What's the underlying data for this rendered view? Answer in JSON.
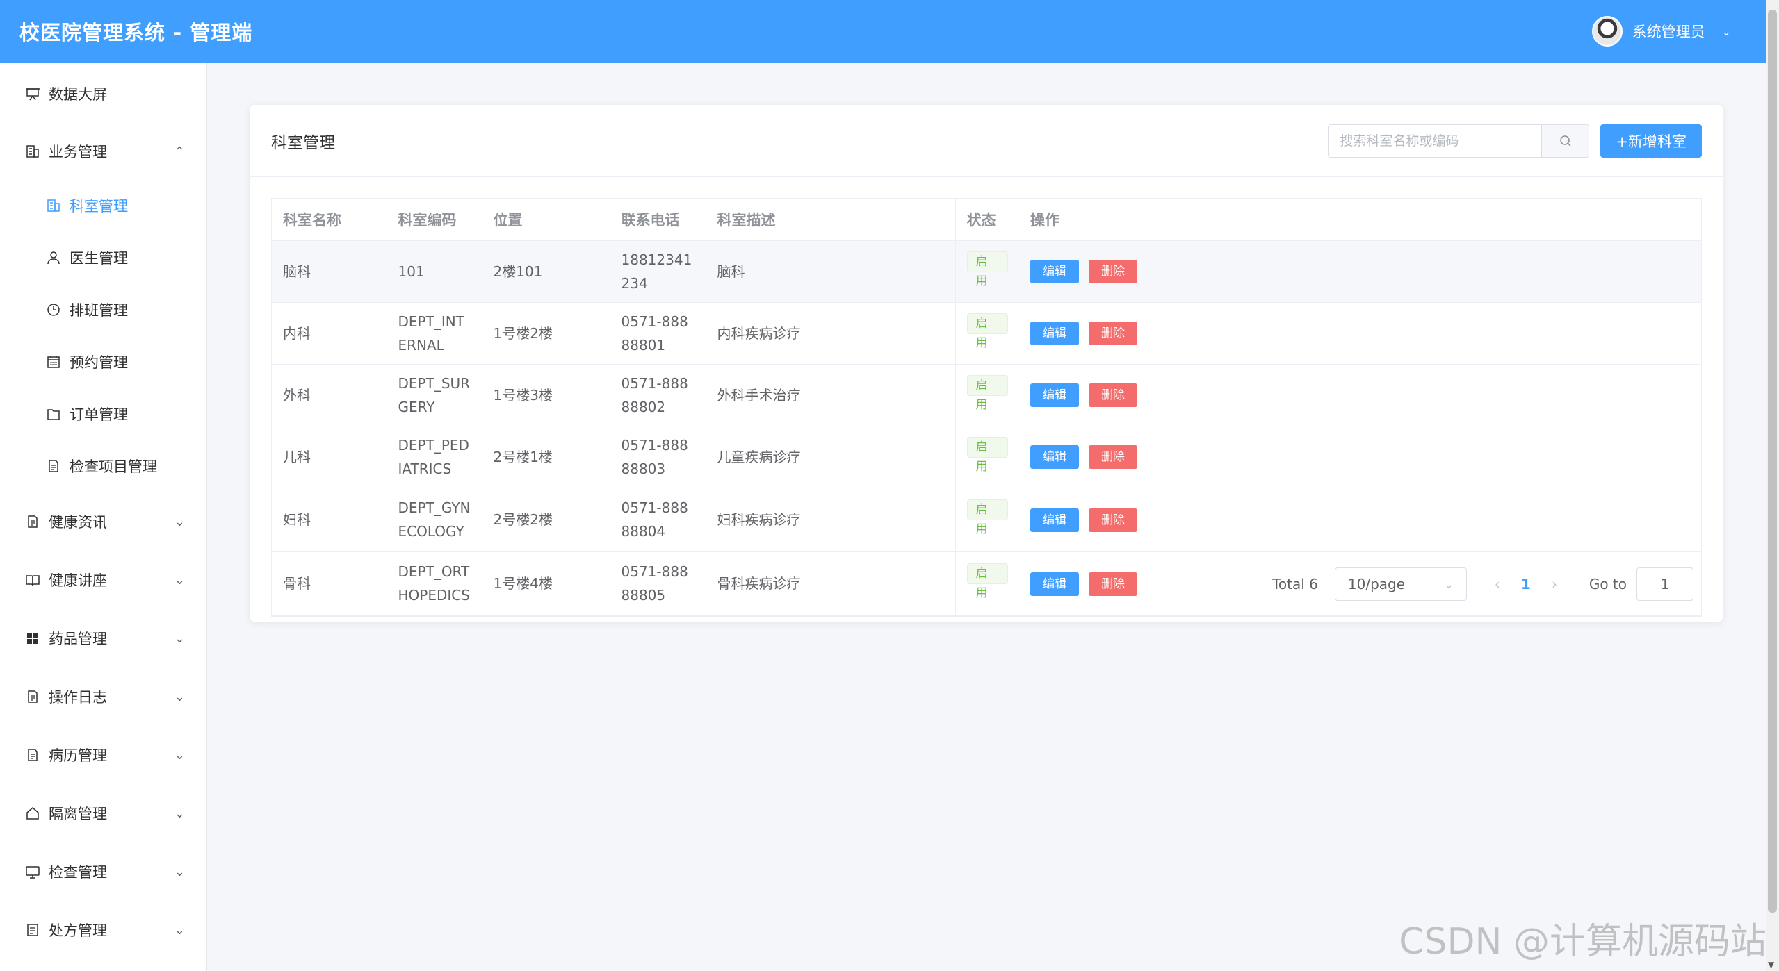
{
  "header": {
    "title": "校医院管理系统 - 管理端",
    "user_name": "系统管理员"
  },
  "sidebar": {
    "items": [
      {
        "label": "数据大屏",
        "icon": "presentation-icon",
        "level": 1,
        "arrow": ""
      },
      {
        "label": "业务管理",
        "icon": "office-building-icon",
        "level": 1,
        "arrow": "⌃"
      },
      {
        "label": "科室管理",
        "icon": "office-building-icon",
        "level": 2,
        "arrow": "",
        "active": true
      },
      {
        "label": "医生管理",
        "icon": "user-icon",
        "level": 2,
        "arrow": ""
      },
      {
        "label": "排班管理",
        "icon": "clock-icon",
        "level": 2,
        "arrow": ""
      },
      {
        "label": "预约管理",
        "icon": "calendar-icon",
        "level": 2,
        "arrow": ""
      },
      {
        "label": "订单管理",
        "icon": "folder-icon",
        "level": 2,
        "arrow": ""
      },
      {
        "label": "检查项目管理",
        "icon": "document-icon",
        "level": 2,
        "arrow": ""
      },
      {
        "label": "健康资讯",
        "icon": "document-icon",
        "level": 1,
        "arrow": "⌄"
      },
      {
        "label": "健康讲座",
        "icon": "book-icon",
        "level": 1,
        "arrow": "⌄"
      },
      {
        "label": "药品管理",
        "icon": "grid-icon",
        "level": 1,
        "arrow": "⌄"
      },
      {
        "label": "操作日志",
        "icon": "document-icon",
        "level": 1,
        "arrow": "⌄"
      },
      {
        "label": "病历管理",
        "icon": "document-icon",
        "level": 1,
        "arrow": "⌄"
      },
      {
        "label": "隔离管理",
        "icon": "house-icon",
        "level": 1,
        "arrow": "⌄"
      },
      {
        "label": "检查管理",
        "icon": "monitor-icon",
        "level": 1,
        "arrow": "⌄"
      },
      {
        "label": "处方管理",
        "icon": "tickets-icon",
        "level": 1,
        "arrow": "⌄"
      }
    ]
  },
  "main": {
    "card_title": "科室管理",
    "search_placeholder": "搜索科室名称或编码",
    "add_button": "+新增科室",
    "table": {
      "headers": [
        "科室名称",
        "科室编码",
        "位置",
        "联系电话",
        "科室描述",
        "状态",
        "操作"
      ],
      "rows": [
        {
          "name": "脑科",
          "code": "101",
          "location": "2楼101",
          "phone": "18812341234",
          "desc": "脑科",
          "status": "启用"
        },
        {
          "name": "内科",
          "code": "DEPT_INTERNAL",
          "location": "1号楼2楼",
          "phone": "0571-88888801",
          "desc": "内科疾病诊疗",
          "status": "启用"
        },
        {
          "name": "外科",
          "code": "DEPT_SURGERY",
          "location": "1号楼3楼",
          "phone": "0571-88888802",
          "desc": "外科手术治疗",
          "status": "启用"
        },
        {
          "name": "儿科",
          "code": "DEPT_PEDIATRICS",
          "location": "2号楼1楼",
          "phone": "0571-88888803",
          "desc": "儿童疾病诊疗",
          "status": "启用"
        },
        {
          "name": "妇科",
          "code": "DEPT_GYNECOLOGY",
          "location": "2号楼2楼",
          "phone": "0571-88888804",
          "desc": "妇科疾病诊疗",
          "status": "启用"
        },
        {
          "name": "骨科",
          "code": "DEPT_ORTHOPEDICS",
          "location": "1号楼4楼",
          "phone": "0571-88888805",
          "desc": "骨科疾病诊疗",
          "status": "启用"
        }
      ],
      "edit_label": "编辑",
      "delete_label": "删除"
    },
    "pagination": {
      "total": "Total 6",
      "page_size": "10/page",
      "current_page": "1",
      "goto_label": "Go to",
      "goto_value": "1"
    }
  },
  "watermark": "CSDN @计算机源码站",
  "colors": {
    "primary": "#409eff",
    "danger": "#f56c6c",
    "success": "#67c23a"
  }
}
